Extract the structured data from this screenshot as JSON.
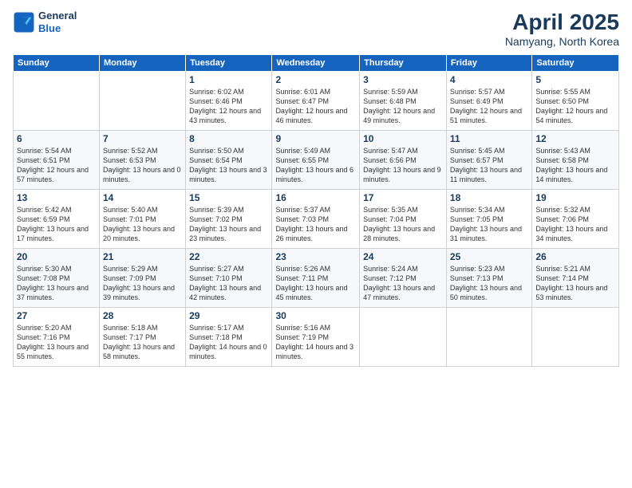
{
  "header": {
    "logo_line1": "General",
    "logo_line2": "Blue",
    "month": "April 2025",
    "location": "Namyang, North Korea"
  },
  "weekdays": [
    "Sunday",
    "Monday",
    "Tuesday",
    "Wednesday",
    "Thursday",
    "Friday",
    "Saturday"
  ],
  "weeks": [
    [
      {
        "day": "",
        "info": ""
      },
      {
        "day": "",
        "info": ""
      },
      {
        "day": "1",
        "info": "Sunrise: 6:02 AM\nSunset: 6:46 PM\nDaylight: 12 hours and 43 minutes."
      },
      {
        "day": "2",
        "info": "Sunrise: 6:01 AM\nSunset: 6:47 PM\nDaylight: 12 hours and 46 minutes."
      },
      {
        "day": "3",
        "info": "Sunrise: 5:59 AM\nSunset: 6:48 PM\nDaylight: 12 hours and 49 minutes."
      },
      {
        "day": "4",
        "info": "Sunrise: 5:57 AM\nSunset: 6:49 PM\nDaylight: 12 hours and 51 minutes."
      },
      {
        "day": "5",
        "info": "Sunrise: 5:55 AM\nSunset: 6:50 PM\nDaylight: 12 hours and 54 minutes."
      }
    ],
    [
      {
        "day": "6",
        "info": "Sunrise: 5:54 AM\nSunset: 6:51 PM\nDaylight: 12 hours and 57 minutes."
      },
      {
        "day": "7",
        "info": "Sunrise: 5:52 AM\nSunset: 6:53 PM\nDaylight: 13 hours and 0 minutes."
      },
      {
        "day": "8",
        "info": "Sunrise: 5:50 AM\nSunset: 6:54 PM\nDaylight: 13 hours and 3 minutes."
      },
      {
        "day": "9",
        "info": "Sunrise: 5:49 AM\nSunset: 6:55 PM\nDaylight: 13 hours and 6 minutes."
      },
      {
        "day": "10",
        "info": "Sunrise: 5:47 AM\nSunset: 6:56 PM\nDaylight: 13 hours and 9 minutes."
      },
      {
        "day": "11",
        "info": "Sunrise: 5:45 AM\nSunset: 6:57 PM\nDaylight: 13 hours and 11 minutes."
      },
      {
        "day": "12",
        "info": "Sunrise: 5:43 AM\nSunset: 6:58 PM\nDaylight: 13 hours and 14 minutes."
      }
    ],
    [
      {
        "day": "13",
        "info": "Sunrise: 5:42 AM\nSunset: 6:59 PM\nDaylight: 13 hours and 17 minutes."
      },
      {
        "day": "14",
        "info": "Sunrise: 5:40 AM\nSunset: 7:01 PM\nDaylight: 13 hours and 20 minutes."
      },
      {
        "day": "15",
        "info": "Sunrise: 5:39 AM\nSunset: 7:02 PM\nDaylight: 13 hours and 23 minutes."
      },
      {
        "day": "16",
        "info": "Sunrise: 5:37 AM\nSunset: 7:03 PM\nDaylight: 13 hours and 26 minutes."
      },
      {
        "day": "17",
        "info": "Sunrise: 5:35 AM\nSunset: 7:04 PM\nDaylight: 13 hours and 28 minutes."
      },
      {
        "day": "18",
        "info": "Sunrise: 5:34 AM\nSunset: 7:05 PM\nDaylight: 13 hours and 31 minutes."
      },
      {
        "day": "19",
        "info": "Sunrise: 5:32 AM\nSunset: 7:06 PM\nDaylight: 13 hours and 34 minutes."
      }
    ],
    [
      {
        "day": "20",
        "info": "Sunrise: 5:30 AM\nSunset: 7:08 PM\nDaylight: 13 hours and 37 minutes."
      },
      {
        "day": "21",
        "info": "Sunrise: 5:29 AM\nSunset: 7:09 PM\nDaylight: 13 hours and 39 minutes."
      },
      {
        "day": "22",
        "info": "Sunrise: 5:27 AM\nSunset: 7:10 PM\nDaylight: 13 hours and 42 minutes."
      },
      {
        "day": "23",
        "info": "Sunrise: 5:26 AM\nSunset: 7:11 PM\nDaylight: 13 hours and 45 minutes."
      },
      {
        "day": "24",
        "info": "Sunrise: 5:24 AM\nSunset: 7:12 PM\nDaylight: 13 hours and 47 minutes."
      },
      {
        "day": "25",
        "info": "Sunrise: 5:23 AM\nSunset: 7:13 PM\nDaylight: 13 hours and 50 minutes."
      },
      {
        "day": "26",
        "info": "Sunrise: 5:21 AM\nSunset: 7:14 PM\nDaylight: 13 hours and 53 minutes."
      }
    ],
    [
      {
        "day": "27",
        "info": "Sunrise: 5:20 AM\nSunset: 7:16 PM\nDaylight: 13 hours and 55 minutes."
      },
      {
        "day": "28",
        "info": "Sunrise: 5:18 AM\nSunset: 7:17 PM\nDaylight: 13 hours and 58 minutes."
      },
      {
        "day": "29",
        "info": "Sunrise: 5:17 AM\nSunset: 7:18 PM\nDaylight: 14 hours and 0 minutes."
      },
      {
        "day": "30",
        "info": "Sunrise: 5:16 AM\nSunset: 7:19 PM\nDaylight: 14 hours and 3 minutes."
      },
      {
        "day": "",
        "info": ""
      },
      {
        "day": "",
        "info": ""
      },
      {
        "day": "",
        "info": ""
      }
    ]
  ]
}
